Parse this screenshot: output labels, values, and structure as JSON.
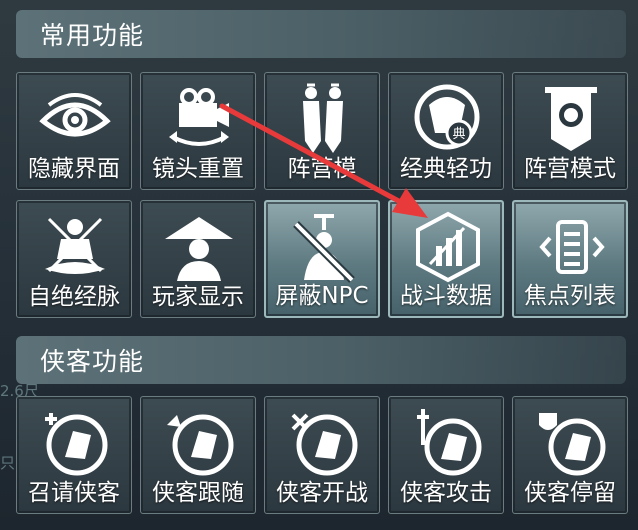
{
  "sections": [
    {
      "title": "常用功能",
      "tiles": [
        {
          "label": "隐藏界面",
          "icon": "eye-icon",
          "active": false
        },
        {
          "label": "镜头重置",
          "icon": "camera-icon",
          "active": false
        },
        {
          "label": "阵营模",
          "icon": "faction-figures-icon",
          "active": false
        },
        {
          "label": "经典轻功",
          "icon": "classic-qinggong-icon",
          "active": false
        },
        {
          "label": "阵营模式",
          "icon": "banner-icon",
          "active": false
        },
        {
          "label": "自绝经脉",
          "icon": "meditation-icon",
          "active": false
        },
        {
          "label": "玩家显示",
          "icon": "straw-hat-icon",
          "active": false
        },
        {
          "label": "屏蔽NPC",
          "icon": "block-npc-icon",
          "active": true
        },
        {
          "label": "战斗数据",
          "icon": "battle-data-icon",
          "active": true
        },
        {
          "label": "焦点列表",
          "icon": "focus-list-icon",
          "active": true
        }
      ]
    },
    {
      "title": "侠客功能",
      "tiles": [
        {
          "label": "召请侠客",
          "icon": "summon-hero-icon",
          "active": false
        },
        {
          "label": "侠客跟随",
          "icon": "hero-follow-icon",
          "active": false
        },
        {
          "label": "侠客开战",
          "icon": "hero-fight-icon",
          "active": false
        },
        {
          "label": "侠客攻击",
          "icon": "hero-attack-icon",
          "active": false
        },
        {
          "label": "侠客停留",
          "icon": "hero-stay-icon",
          "active": false
        }
      ]
    }
  ],
  "background": {
    "distance": "2.6尺",
    "fragment": "只"
  },
  "colors": {
    "arrow": "#e83a3a",
    "active_tile": "#8fa8ad"
  }
}
